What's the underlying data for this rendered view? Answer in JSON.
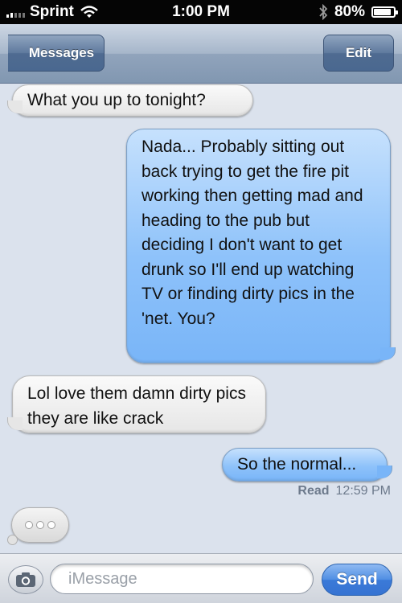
{
  "status_bar": {
    "carrier": "Sprint",
    "time": "1:00 PM",
    "battery": "80%",
    "battery_level": 0.8
  },
  "nav": {
    "back_label": "Messages",
    "edit_label": "Edit"
  },
  "messages": [
    {
      "direction": "incoming",
      "text": "What you up to tonight?"
    },
    {
      "direction": "outgoing",
      "text": "Nada... Probably sitting out back trying to get the fire pit working then getting mad and heading to the pub but deciding I don't want to get drunk so I'll end up watching TV or finding dirty pics in the 'net. You?"
    },
    {
      "direction": "incoming",
      "text": "Lol love them damn dirty pics they are like crack"
    },
    {
      "direction": "outgoing",
      "text": "So the normal..."
    }
  ],
  "receipt": {
    "label": "Read",
    "time": "12:59 PM"
  },
  "composer": {
    "placeholder": "iMessage",
    "send_label": "Send"
  },
  "icons": {
    "camera": "camera-icon",
    "wifi": "wifi-icon",
    "bluetooth": "bluetooth-icon",
    "signal": "signal-bars-icon",
    "battery": "battery-icon",
    "typing": "typing-indicator-icon"
  },
  "colors": {
    "outgoing_bubble": "#8ec2fa",
    "incoming_bubble": "#ececec",
    "send_button": "#4a88df",
    "nav_bar": "#94a8c0"
  }
}
